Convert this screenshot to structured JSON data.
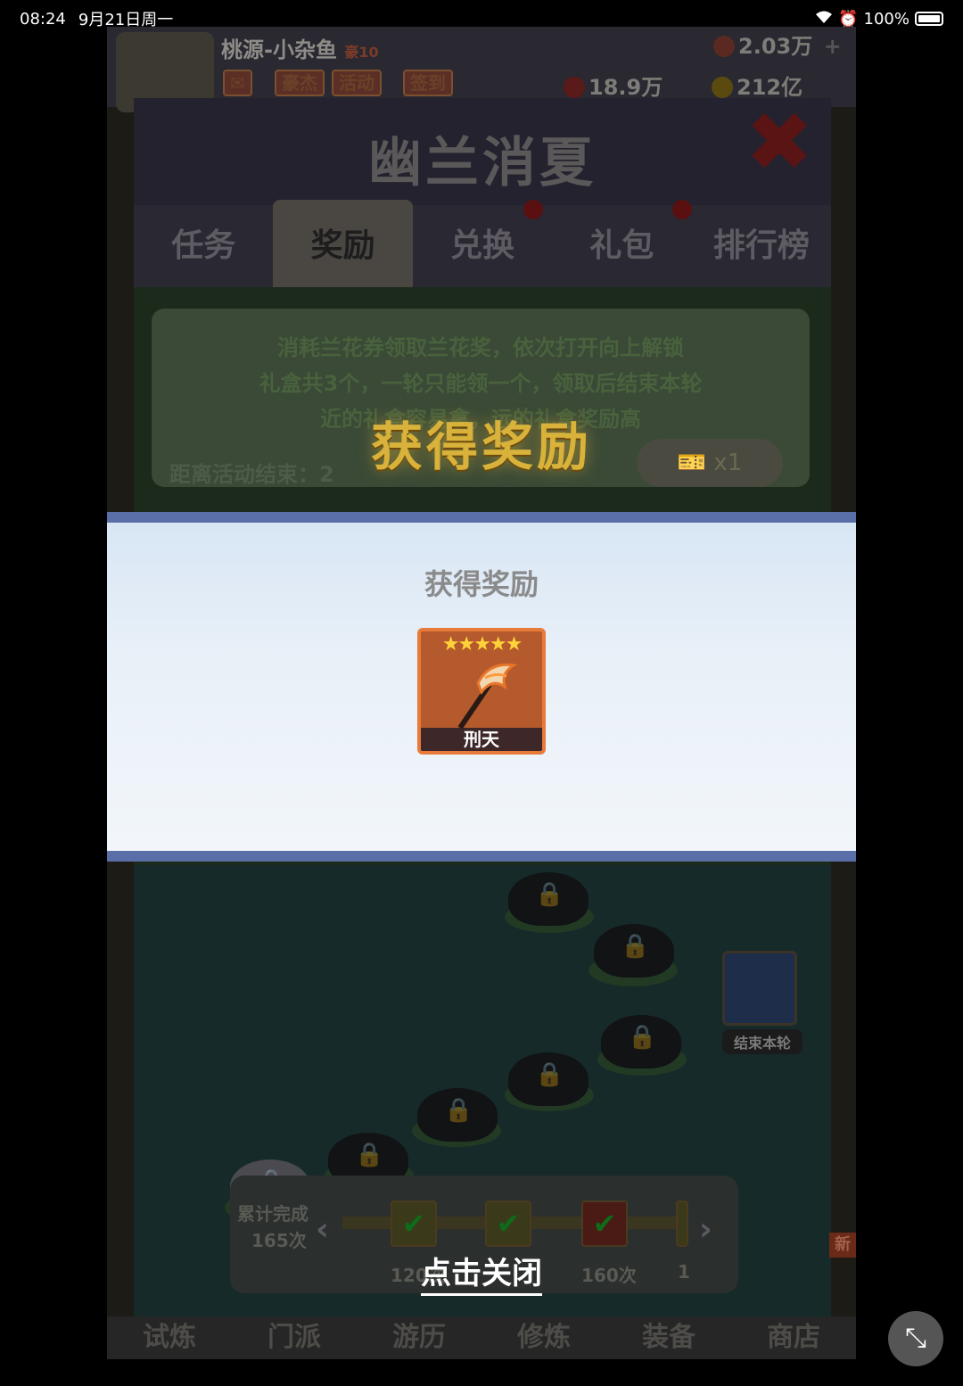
{
  "status_bar": {
    "time": "08:24",
    "date": "9月21日周一",
    "battery": "100%"
  },
  "game": {
    "player_name": "桃源-小杂鱼",
    "vip": "豪10",
    "top_buttons": [
      "豪杰",
      "活动",
      "签到"
    ],
    "gems": "2.03万",
    "power": "18.9万",
    "gold": "212亿",
    "panel_title": "幽兰消夏",
    "tabs": [
      "任务",
      "奖励",
      "兑换",
      "礼包",
      "排行榜"
    ],
    "active_tab": "奖励",
    "info_lines": [
      "消耗兰花券领取兰花奖，依次打开向上解锁",
      "礼盒共3个，一轮只能领一个，领取后结束本轮",
      "近的礼盒容易拿，远的礼盒奖励高"
    ],
    "countdown_label": "距离活动结束：2",
    "ticket_count": "x1",
    "end_round_label": "结束本轮",
    "cumulative_label": "累计完成",
    "cumulative_count": "165次",
    "milestones": [
      "120次",
      "160次",
      "1"
    ],
    "bottom_nav": [
      "试炼",
      "门派",
      "游历",
      "修炼",
      "装备",
      "商店"
    ],
    "new_badge": "新"
  },
  "reward": {
    "banner": "获得奖励",
    "title": "获得奖励",
    "item_name": "刑天",
    "item_stars": 5,
    "stars_text": "★★★★★",
    "close_hint": "点击关闭"
  },
  "colors": {
    "panel_border": "#5a6fa8",
    "item_frame": "#e87a3a",
    "banner_gold": "#d8b23a"
  },
  "icons": {
    "close": "close-x-icon",
    "shrink": "shrink-window-icon"
  }
}
